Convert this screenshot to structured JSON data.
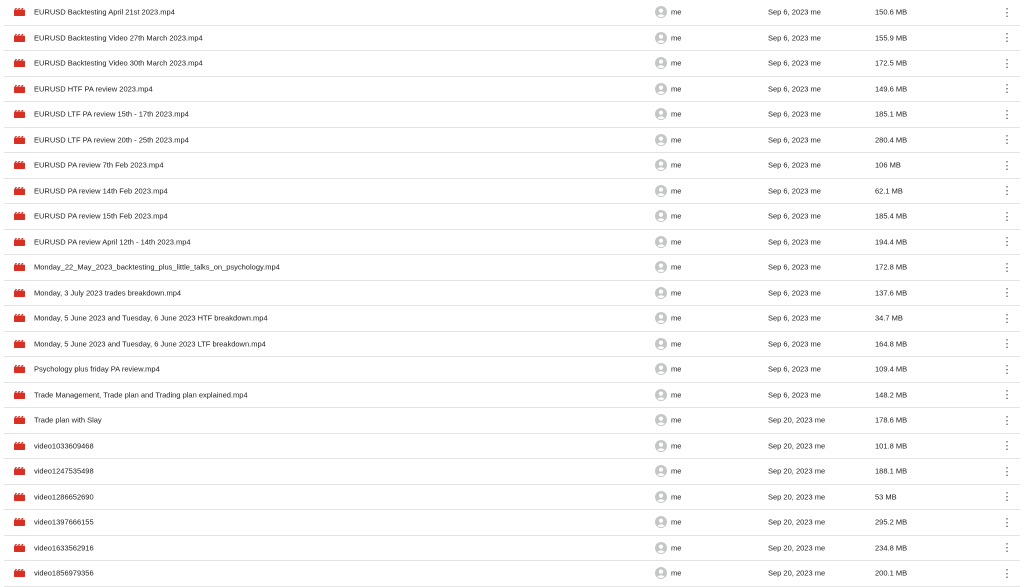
{
  "colors": {
    "video_icon": "#d93025",
    "avatar": "#c4c7c5",
    "divider": "#e3e3e3"
  },
  "icons": {
    "file_type": "video-file-icon",
    "owner": "account-circle-icon",
    "more": "more-vert-icon"
  },
  "more_glyph": "⋮",
  "files": [
    {
      "name": "EURUSD Backtesting April 21st 2023.mp4",
      "owner": "me",
      "modified": "Sep 6, 2023 me",
      "size": "150.6 MB"
    },
    {
      "name": "EURUSD Backtesting Video 27th March 2023.mp4",
      "owner": "me",
      "modified": "Sep 6, 2023 me",
      "size": "155.9 MB"
    },
    {
      "name": "EURUSD Backtesting Video 30th March 2023.mp4",
      "owner": "me",
      "modified": "Sep 6, 2023 me",
      "size": "172.5 MB"
    },
    {
      "name": "EURUSD HTF PA review 2023.mp4",
      "owner": "me",
      "modified": "Sep 6, 2023 me",
      "size": "149.6 MB"
    },
    {
      "name": "EURUSD LTF PA review 15th - 17th 2023.mp4",
      "owner": "me",
      "modified": "Sep 6, 2023 me",
      "size": "185.1 MB"
    },
    {
      "name": "EURUSD LTF PA review 20th - 25th 2023.mp4",
      "owner": "me",
      "modified": "Sep 6, 2023 me",
      "size": "280.4 MB"
    },
    {
      "name": "EURUSD PA review 7th Feb 2023.mp4",
      "owner": "me",
      "modified": "Sep 6, 2023 me",
      "size": "106 MB"
    },
    {
      "name": "EURUSD PA review 14th Feb 2023.mp4",
      "owner": "me",
      "modified": "Sep 6, 2023 me",
      "size": "62.1 MB"
    },
    {
      "name": "EURUSD PA review 15th Feb 2023.mp4",
      "owner": "me",
      "modified": "Sep 6, 2023 me",
      "size": "185.4 MB"
    },
    {
      "name": "EURUSD PA review April 12th - 14th 2023.mp4",
      "owner": "me",
      "modified": "Sep 6, 2023 me",
      "size": "194.4 MB"
    },
    {
      "name": "Monday_22_May_2023_backtesting_plus_little_talks_on_psychology.mp4",
      "owner": "me",
      "modified": "Sep 6, 2023 me",
      "size": "172.8 MB"
    },
    {
      "name": "Monday, 3 July 2023 trades breakdown.mp4",
      "owner": "me",
      "modified": "Sep 6, 2023 me",
      "size": "137.6 MB"
    },
    {
      "name": "Monday, 5 June 2023 and Tuesday, 6 June 2023 HTF breakdown.mp4",
      "owner": "me",
      "modified": "Sep 6, 2023 me",
      "size": "34.7 MB"
    },
    {
      "name": "Monday, 5 June 2023 and Tuesday, 6 June 2023 LTF breakdown.mp4",
      "owner": "me",
      "modified": "Sep 6, 2023 me",
      "size": "164.8 MB"
    },
    {
      "name": "Psychology plus friday PA review.mp4",
      "owner": "me",
      "modified": "Sep 6, 2023 me",
      "size": "109.4 MB"
    },
    {
      "name": "Trade Management, Trade plan and Trading plan explained.mp4",
      "owner": "me",
      "modified": "Sep 6, 2023 me",
      "size": "148.2 MB"
    },
    {
      "name": "Trade plan with Slay",
      "owner": "me",
      "modified": "Sep 20, 2023 me",
      "size": "178.6 MB"
    },
    {
      "name": "video1033609468",
      "owner": "me",
      "modified": "Sep 20, 2023 me",
      "size": "101.8 MB"
    },
    {
      "name": "video1247535498",
      "owner": "me",
      "modified": "Sep 20, 2023 me",
      "size": "188.1 MB"
    },
    {
      "name": "video1286652690",
      "owner": "me",
      "modified": "Sep 20, 2023 me",
      "size": "53 MB"
    },
    {
      "name": "video1397666155",
      "owner": "me",
      "modified": "Sep 20, 2023 me",
      "size": "295.2 MB"
    },
    {
      "name": "video1633562916",
      "owner": "me",
      "modified": "Sep 20, 2023 me",
      "size": "234.8 MB"
    },
    {
      "name": "video1856979356",
      "owner": "me",
      "modified": "Sep 20, 2023 me",
      "size": "200.1 MB"
    }
  ]
}
